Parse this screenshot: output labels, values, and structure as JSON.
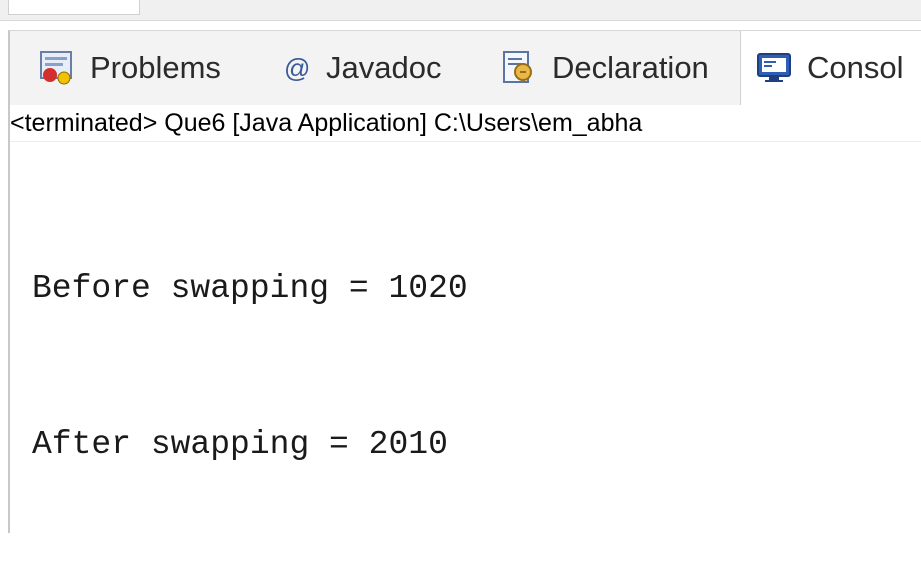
{
  "tabs": {
    "problems": "Problems",
    "javadoc": "Javadoc",
    "declaration": "Declaration",
    "console": "Consol"
  },
  "status": "<terminated> Que6 [Java Application] C:\\Users\\em_abha",
  "console": {
    "lines": [
      "Before swapping = 1020",
      "After swapping = 2010"
    ]
  },
  "icons": {
    "problems": "problems-icon",
    "javadoc": "at-sign-icon",
    "declaration": "declaration-icon",
    "console": "console-monitor-icon"
  }
}
